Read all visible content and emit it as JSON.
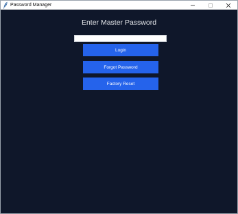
{
  "window": {
    "title": "Password Manager",
    "app_icon": "feather-icon",
    "controls": [
      "minimize-icon",
      "maximize-icon",
      "close-icon"
    ]
  },
  "main": {
    "heading": "Enter Master Password",
    "password_value": "",
    "buttons": {
      "login": "Login",
      "forgot": "Forgot Password",
      "reset": "Factory Reset"
    }
  },
  "colors": {
    "background": "#0f172a",
    "button": "#2563eb",
    "button_text": "#ffffff",
    "heading_text": "#e5e7eb"
  }
}
